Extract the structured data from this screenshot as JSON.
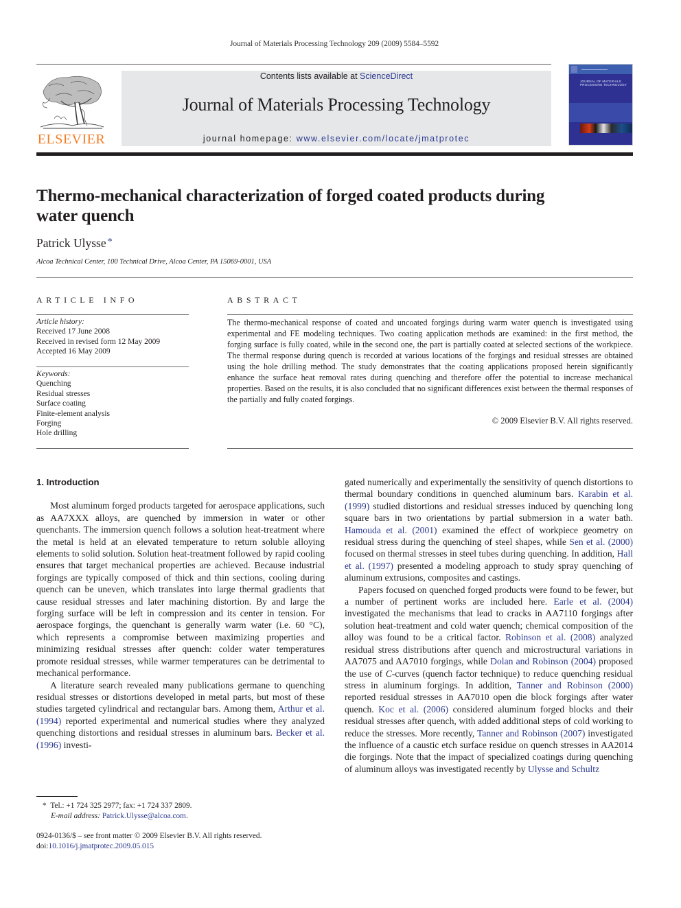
{
  "running_head": "Journal of Materials Processing Technology 209 (2009) 5584–5592",
  "masthead": {
    "publisher_logo_text": "ELSEVIER",
    "contents_prefix": "Contents lists available at ",
    "contents_link": "ScienceDirect",
    "journal_title": "Journal of Materials Processing Technology",
    "homepage_prefix": "journal homepage: ",
    "homepage_url": "www.elsevier.com/locate/jmatprotec",
    "cover_title": "JOURNAL OF MATERIALS PROCESSING TECHNOLOGY"
  },
  "article": {
    "title": "Thermo-mechanical characterization of forged coated products during water quench",
    "author": "Patrick Ulysse",
    "author_mark": "*",
    "affiliation": "Alcoa Technical Center, 100 Technical Drive, Alcoa Center, PA 15069-0001, USA"
  },
  "article_info": {
    "heading": "ARTICLE INFO",
    "history_label": "Article history:",
    "history": [
      "Received 17 June 2008",
      "Received in revised form 12 May 2009",
      "Accepted 16 May 2009"
    ],
    "keywords_label": "Keywords:",
    "keywords": [
      "Quenching",
      "Residual stresses",
      "Surface coating",
      "Finite-element analysis",
      "Forging",
      "Hole drilling"
    ]
  },
  "abstract": {
    "heading": "ABSTRACT",
    "text": "The thermo-mechanical response of coated and uncoated forgings during warm water quench is investigated using experimental and FE modeling techniques. Two coating application methods are examined: in the first method, the forging surface is fully coated, while in the second one, the part is partially coated at selected sections of the workpiece. The thermal response during quench is recorded at various locations of the forgings and residual stresses are obtained using the hole drilling method. The study demonstrates that the coating applications proposed herein significantly enhance the surface heat removal rates during quenching and therefore offer the potential to increase mechanical properties. Based on the results, it is also concluded that no significant differences exist between the thermal responses of the partially and fully coated forgings.",
    "copyright": "© 2009 Elsevier B.V. All rights reserved."
  },
  "body": {
    "section_title": "1.  Introduction",
    "p1": "Most aluminum forged products targeted for aerospace applications, such as AA7XXX alloys, are quenched by immersion in water or other quenchants. The immersion quench follows a solution heat-treatment where the metal is held at an elevated temperature to return soluble alloying elements to solid solution. Solution heat-treatment followed by rapid cooling ensures that target mechanical properties are achieved. Because industrial forgings are typically composed of thick and thin sections, cooling during quench can be uneven, which translates into large thermal gradients that cause residual stresses and later machining distortion. By and large the forging surface will be left in compression and its center in tension. For aerospace forgings, the quenchant is generally warm water (i.e. 60 °C), which represents a compromise between maximizing properties and minimizing residual stresses after quench: colder water temperatures promote residual stresses, while warmer temperatures can be detrimental to mechanical performance.",
    "p2": [
      {
        "t": "A literature search revealed many publications germane to quenching residual stresses or distortions developed in metal parts, but most of these studies targeted cylindrical and rectangular bars. Among them, "
      },
      {
        "t": "Arthur et al. (1994)",
        "link": true
      },
      {
        "t": " reported experimental and numerical studies where they analyzed quenching distortions and residual stresses in aluminum bars. "
      },
      {
        "t": "Becker et al. (1996)",
        "link": true
      },
      {
        "t": " investigated numerically and experimentally the sensitivity of quench distortions to thermal boundary conditions in quenched aluminum bars. "
      },
      {
        "t": "Karabin et al. (1999)",
        "link": true
      },
      {
        "t": " studied distortions and residual stresses induced by quenching long square bars in two orientations by partial submersion in a water bath. "
      },
      {
        "t": "Hamouda et al. (2001)",
        "link": true
      },
      {
        "t": " examined the effect of workpiece geometry on residual stress during the quenching of steel shapes, while "
      },
      {
        "t": "Sen et al. (2000)",
        "link": true
      },
      {
        "t": " focused on thermal stresses in steel tubes during quenching. In addition, "
      },
      {
        "t": "Hall et al. (1997)",
        "link": true
      },
      {
        "t": " presented a modeling approach to study spray quenching of aluminum extrusions, composites and castings."
      }
    ],
    "p2_left": [
      {
        "t": "A literature search revealed many publications germane to quenching residual stresses or distortions developed in metal parts, but most of these studies targeted cylindrical and rectangular bars. Among them, "
      },
      {
        "t": "Arthur et al. (1994)",
        "link": true
      },
      {
        "t": " reported experimental and numerical studies where they analyzed quenching distortions and residual stresses in aluminum bars. "
      },
      {
        "t": "Becker et al. (1996)",
        "link": true
      },
      {
        "t": " investi-"
      }
    ],
    "p2_right": [
      {
        "t": "gated numerically and experimentally the sensitivity of quench distortions to thermal boundary conditions in quenched aluminum bars. "
      },
      {
        "t": "Karabin et al. (1999)",
        "link": true
      },
      {
        "t": " studied distortions and residual stresses induced by quenching long square bars in two orientations by partial submersion in a water bath. "
      },
      {
        "t": "Hamouda et al. (2001)",
        "link": true
      },
      {
        "t": " examined the effect of workpiece geometry on residual stress during the quenching of steel shapes, while "
      },
      {
        "t": "Sen et al. (2000)",
        "link": true
      },
      {
        "t": " focused on thermal stresses in steel tubes during quenching. In addition, "
      },
      {
        "t": "Hall et al. (1997)",
        "link": true
      },
      {
        "t": " presented a modeling approach to study spray quenching of aluminum extrusions, composites and castings."
      }
    ],
    "p3": [
      {
        "t": "Papers focused on quenched forged products were found to be fewer, but a number of pertinent works are included here. "
      },
      {
        "t": "Earle et al. (2004)",
        "link": true
      },
      {
        "t": " investigated the mechanisms that lead to cracks in AA7110 forgings after solution heat-treatment and cold water quench; chemical composition of the alloy was found to be a critical factor. "
      },
      {
        "t": "Robinson et al. (2008)",
        "link": true
      },
      {
        "t": " analyzed residual stress distributions after quench and microstructural variations in AA7075 and AA7010 forgings, while "
      },
      {
        "t": "Dolan and Robinson (2004)",
        "link": true
      },
      {
        "t": " proposed the use of "
      },
      {
        "t": "C",
        "italic": true
      },
      {
        "t": "-curves (quench factor technique) to reduce quenching residual stress in aluminum forgings. In addition, "
      },
      {
        "t": "Tanner and Robinson (2000)",
        "link": true
      },
      {
        "t": " reported residual stresses in AA7010 open die block forgings after water quench. "
      },
      {
        "t": "Koc et al. (2006)",
        "link": true
      },
      {
        "t": " considered aluminum forged blocks and their residual stresses after quench, with added additional steps of cold working to reduce the stresses. More recently, "
      },
      {
        "t": "Tanner and Robinson (2007)",
        "link": true
      },
      {
        "t": " investigated the influence of a caustic etch surface residue on quench stresses in AA2014 die forgings. Note that the impact of specialized coatings during quenching of aluminum alloys was investigated recently by "
      },
      {
        "t": "Ulysse and Schultz",
        "link": true
      }
    ]
  },
  "footnote": {
    "mark": "*",
    "contact": "Tel.: +1 724 325 2977; fax: +1 724 337 2809.",
    "email_label": "E-mail address: ",
    "email": "Patrick.Ulysse@alcoa.com",
    "email_suffix": "."
  },
  "front_matter": {
    "issn_line": "0924-0136/$ – see front matter © 2009 Elsevier B.V. All rights reserved.",
    "doi_prefix": "doi:",
    "doi": "10.1016/j.jmatprotec.2009.05.015"
  },
  "colors": {
    "link": "#2b3990",
    "elsevier_orange": "#f47b20",
    "banner_bg": "#e6e7e8",
    "cover_blue": "#2e3192"
  }
}
